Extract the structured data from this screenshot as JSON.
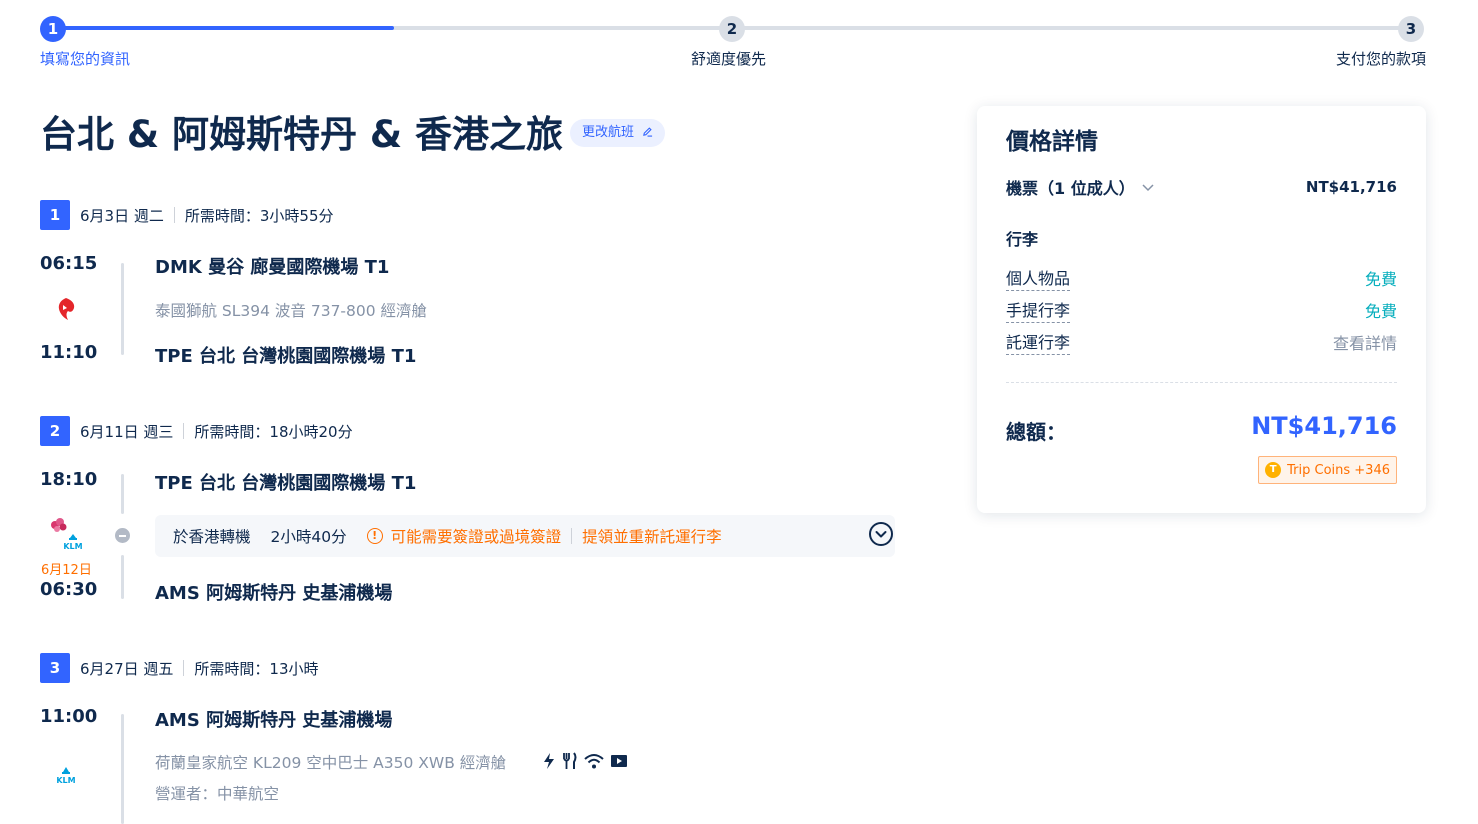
{
  "progress": {
    "steps": [
      {
        "num": "1",
        "label": "填寫您的資訊"
      },
      {
        "num": "2",
        "label": "舒適度優先"
      },
      {
        "num": "3",
        "label": "支付您的款項"
      }
    ],
    "completion_fraction": 0.25
  },
  "trip": {
    "title": "台北 & 阿姆斯特丹 & 香港之旅",
    "change_flight": "更改航班"
  },
  "segments": [
    {
      "num": "1",
      "date": "6月3日 週二",
      "duration": "所需時間：3小時55分",
      "depart_time": "06:15",
      "depart_airport": "DMK 曼谷 廊曼國際機場 T1",
      "flight_info": "泰國獅航   SL394   波音 737-800   經濟艙",
      "arrive_time": "11:10",
      "arrive_airport": "TPE 台北 台灣桃園國際機場 T1"
    },
    {
      "num": "2",
      "date": "6月11日 週三",
      "duration": "所需時間：18小時20分",
      "depart_time": "18:10",
      "depart_airport": "TPE 台北 台灣桃園國際機場 T1",
      "transfer_city": "於香港轉機",
      "transfer_duration": "2小時40分",
      "transfer_warning": "可能需要簽證或過境簽證",
      "transfer_baggage": "提領並重新託運行李",
      "arrive_date": "6月12日",
      "arrive_time": "06:30",
      "arrive_airport": "AMS 阿姆斯特丹 史基浦機場"
    },
    {
      "num": "3",
      "date": "6月27日 週五",
      "duration": "所需時間：13小時",
      "depart_time": "11:00",
      "depart_airport": "AMS 阿姆斯特丹 史基浦機場",
      "flight_info": "荷蘭皇家航空   KL209   空中巴士 A350 XWB   經濟艙",
      "operator": "營運者：中華航空"
    }
  ],
  "price": {
    "title": "價格詳情",
    "ticket_label": "機票（1 位成人）",
    "ticket_value": "NT$41,716",
    "baggage_title": "行李",
    "personal_item": "個人物品",
    "personal_item_value": "免費",
    "carry_on": "手提行李",
    "carry_on_value": "免費",
    "checked": "託運行李",
    "checked_value": "查看詳情",
    "total_label": "總額：",
    "total_value": "NT$41,716",
    "coins": "Trip Coins +346"
  },
  "colors": {
    "accent": "#3264ff",
    "text": "#0f294d",
    "warning": "#ff6f00",
    "free": "#06aebd"
  }
}
